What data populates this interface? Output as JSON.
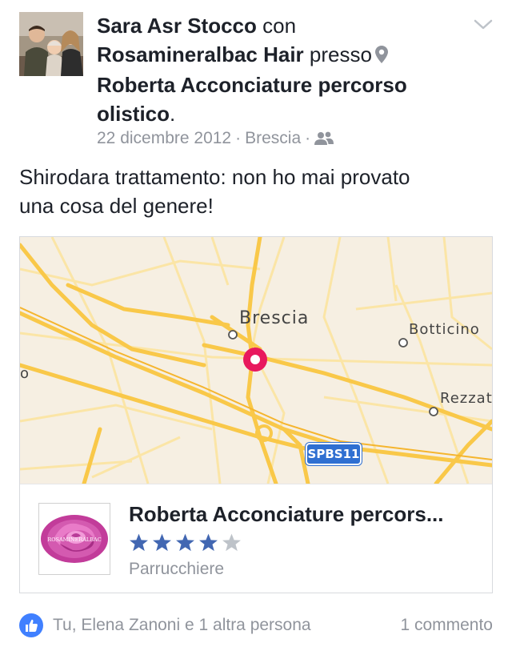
{
  "post": {
    "author": "Sara Asr Stocco",
    "with_word": "con",
    "tagged": "Rosamineralbac Hair",
    "at_word": "presso",
    "location_line1": "Roberta Acconciature percorso",
    "location_line2": "olistico",
    "period": ".",
    "date": "22 dicembre 2012",
    "city": "Brescia",
    "separator": "·",
    "audience_icon": "friends-icon",
    "text_line1": "Shirodara trattamento: non ho mai provato",
    "text_line2": "una cosa del genere!"
  },
  "map": {
    "labels": {
      "brescia": "Brescia",
      "botticino": "Botticino",
      "rezzato": "Rezzat",
      "edge": "o"
    },
    "road_badge": "SPBS11",
    "pin_color": "#e8185e",
    "road_color": "#f9c849"
  },
  "place": {
    "name": "Roberta Acconciature percors...",
    "thumb_text": "ROSAMINERALBAC",
    "rating": 4,
    "max_rating": 5,
    "category": "Parrucchiere",
    "star_color": "#4267b2"
  },
  "footer": {
    "likers": "Tu, Elena Zanoni e 1 altra persona",
    "comments": "1 commento",
    "like_color": "#4080ff"
  }
}
